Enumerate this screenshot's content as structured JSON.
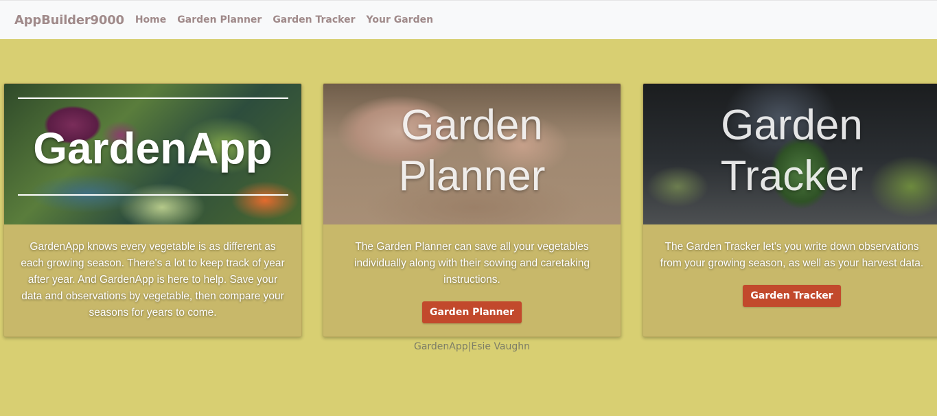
{
  "navbar": {
    "brand": "AppBuilder9000",
    "links": [
      "Home",
      "Garden Planner",
      "Garden Tracker",
      "Your Garden"
    ]
  },
  "cards": [
    {
      "image_title": "GardenApp",
      "text": "GardenApp knows every vegetable is as different as each growing season. There's a lot to keep track of year after year. And GardenApp is here to help. Save your data and observations by vegetable, then compare your seasons for years to come."
    },
    {
      "image_title_line1": "Garden",
      "image_title_line2": "Planner",
      "text": "The Garden Planner can save all your vegetables individually along with their sowing and caretaking instructions.",
      "button": "Garden Planner"
    },
    {
      "image_title_line1": "Garden",
      "image_title_line2": "Tracker",
      "text": "The Garden Tracker let's you write down observations from your growing season, as well as your harvest data.",
      "button": "Garden Tracker"
    }
  ],
  "footer": "GardenApp|Esie Vaughn",
  "colors": {
    "background": "#d8cf72",
    "card": "#c8b86a",
    "button": "#c2492c",
    "navbar": "#f8f9fa",
    "nav_text": "#a08a8a"
  }
}
